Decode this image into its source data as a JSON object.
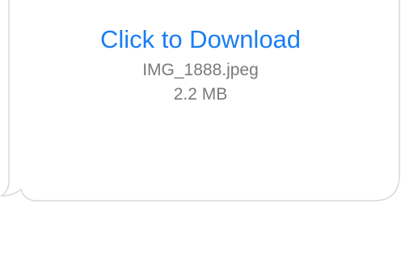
{
  "attachment": {
    "download_label": "Click to Download",
    "file_name": "IMG_1888.jpeg",
    "file_size": "2.2 MB"
  },
  "colors": {
    "link": "#1a7ef2",
    "secondary_text": "#7a7a7a",
    "bubble_border": "#d9d9d9",
    "bubble_fill": "#ffffff"
  }
}
